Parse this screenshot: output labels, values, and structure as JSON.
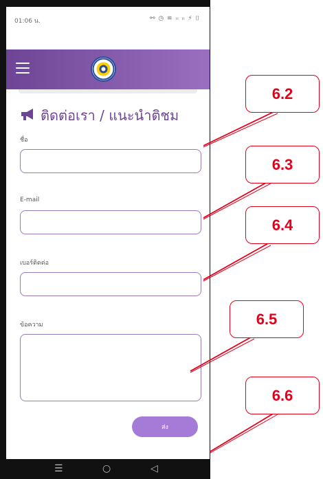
{
  "status_bar": {
    "time": "01:06 น.",
    "icons": "⚯ ◷ ≋ ᵢₗ ᵢₗ ⚡ ⌷"
  },
  "heading": "ติดต่อเรา / แนะนำติชม",
  "form": {
    "name_label": "ชื่อ",
    "email_label": "E-mail",
    "phone_label": "เบอร์ติดต่อ",
    "message_label": "ข้อความ",
    "name_value": "",
    "email_value": "",
    "phone_value": "",
    "message_value": "",
    "send_label": "ส่ง"
  },
  "nav": {
    "recent": "☰",
    "home": "○",
    "back": "◁"
  },
  "callouts": [
    "6.2",
    "6.3",
    "6.4",
    "6.5",
    "6.6"
  ],
  "colors": {
    "brand_purple": "#6e4596",
    "button_purple": "#a57bd8",
    "annotation_red": "#e4001b"
  }
}
